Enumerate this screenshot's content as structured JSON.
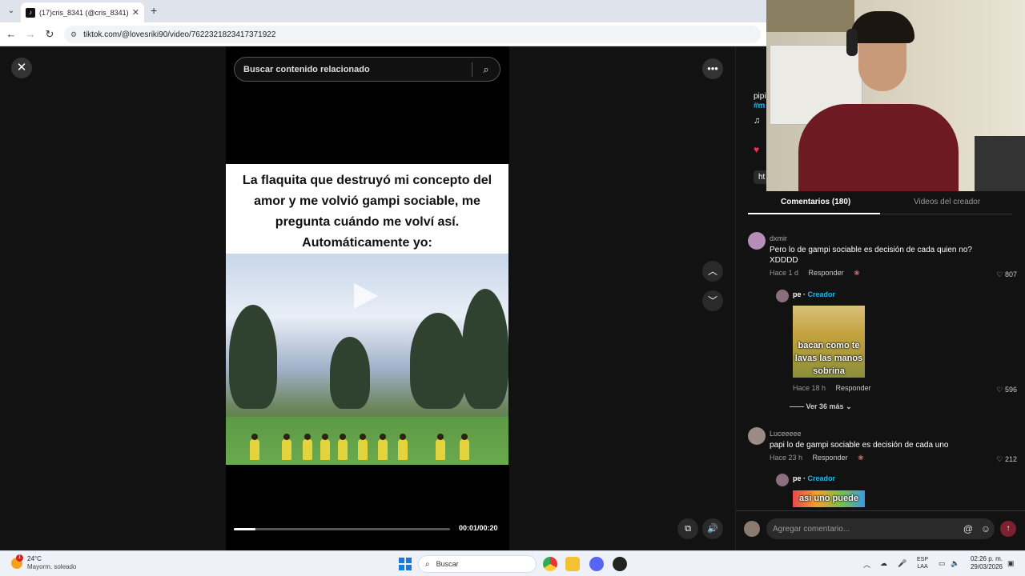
{
  "browser": {
    "tab_title": "(17)cris_8341 (@cris_8341) | Tik",
    "tab_close": "✕",
    "new_tab": "+",
    "url": "tiktok.com/@lovesriki90/video/7622321823417371922"
  },
  "player": {
    "search_placeholder": "Buscar contenido relacionado",
    "caption": "La flaquita que destruyó mi concepto del amor y me volvió gampi sociable, me pregunta cuándo me volví así. Automáticamente yo:",
    "time": "00:01/00:20",
    "progress": 0.1
  },
  "panel": {
    "stub_name": "pipi",
    "stub_tag": "#m",
    "stub_link": "ht",
    "tabs": {
      "comments": "Comentarios (180)",
      "creator_videos": "Videos del creador"
    },
    "comments": [
      {
        "user": "dxmir",
        "text": "Pero lo de gampi sociable es decisión de cada quien no? XDDDD",
        "time": "Hace 1 d",
        "reply_label": "Responder",
        "likes": "807",
        "reply": {
          "user": "pe",
          "badge": "Creador",
          "image_text": "bacan como te lavas las manos sobrina",
          "time": "Hace 18 h",
          "reply_label": "Responder",
          "likes": "596"
        },
        "more": "Ver 36 más"
      },
      {
        "user": "Luceeeee",
        "text": "papi lo de gampi sociable es decisión de cada uno",
        "time": "Hace 23 h",
        "reply_label": "Responder",
        "likes": "212",
        "reply": {
          "user": "pe",
          "badge": "Creador",
          "image_text": "asi uno puede"
        }
      }
    ],
    "comment_placeholder": "Agregar comentario..."
  },
  "taskbar": {
    "temperature": "24°C",
    "weather": "Mayorm. soleado",
    "weather_badge": "1",
    "search": "Buscar",
    "lang_top": "ESP",
    "lang_bottom": "LAA",
    "time": "02:26 p. m.",
    "date": "29/03/2026"
  }
}
